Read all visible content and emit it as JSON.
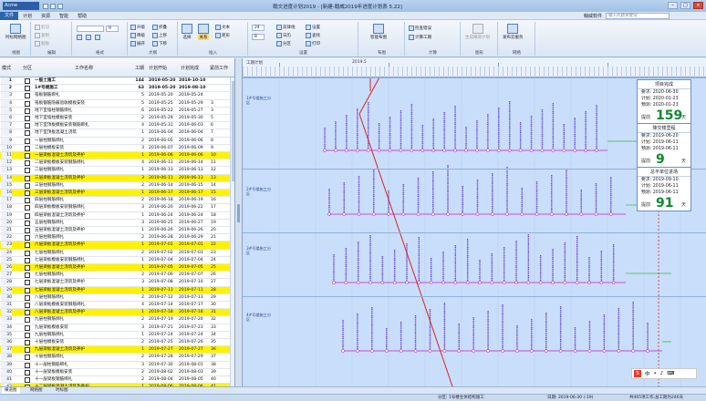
{
  "app": {
    "logo": "Acme",
    "title": "翰文进度计划2019 - [新建-翰威2019年进度计划表 5.22]"
  },
  "menu": {
    "items": [
      "文件",
      "计划",
      "资源",
      "智能",
      "帮助"
    ],
    "active": "文件",
    "right_label": "翰威软件",
    "search_placeholder": "输入问题关键词"
  },
  "ribbon": {
    "groups": [
      "视图",
      "编辑",
      "格式",
      "大纲",
      "插入",
      "设置",
      "布图",
      "计算",
      "图形",
      "网络"
    ],
    "buttons": {
      "timescale_view": "时标网络图",
      "edit1": "剪切",
      "edit2": "复制",
      "edit3": "粘贴",
      "outline1": "升级",
      "outline2": "降级",
      "outline3": "展开",
      "outline4": "折叠",
      "outline5": "上移",
      "outline6": "下移",
      "insert_select": "选择",
      "insert_relate": "关系",
      "insert_text": "文本",
      "insert_rect": "矩形",
      "settings1": "前锋线",
      "settings2": "日历",
      "settings3": "分区",
      "settings4": "设置",
      "settings5": "查找",
      "settings6": "打印",
      "layout_smart": "智能布图",
      "calc1": "检查错误",
      "calc2": "计算工期",
      "publish": "生成横道计划",
      "network": "发布云服务"
    },
    "numbers": {
      "font_size": "9",
      "zoom1": "24",
      "zoom2": "8"
    }
  },
  "grid": {
    "headers": {
      "col_mode": "模式",
      "col_partition": "分区",
      "col_name": "工作名称",
      "col_duration": "工期",
      "col_start": "计划开始",
      "col_end": "计划完成",
      "col_predecessor": "紧前工作"
    },
    "rows": [
      {
        "idx": "1",
        "name": "一般土施工",
        "dur": "144",
        "start": "2019-05-20",
        "end": "2019-10-10",
        "pred": "",
        "hl": false,
        "sum": true
      },
      {
        "idx": "2",
        "name": "1#号楼施工",
        "dur": "63",
        "start": "2019-05-20",
        "end": "2019-08-10",
        "pred": "",
        "hl": false,
        "sum": true
      },
      {
        "idx": "3",
        "name": "筏板钢筋绑扎",
        "dur": "5",
        "start": "2019-05-20",
        "end": "2019-05-24",
        "pred": "",
        "hl": false
      },
      {
        "idx": "4",
        "name": "筏板钢筋隐蔽验收模板安装",
        "dur": "5",
        "start": "2019-05-25",
        "end": "2019-05-29",
        "pred": "3",
        "hl": false
      },
      {
        "idx": "5",
        "name": "地下室墙柱钢筋绑扎",
        "dur": "6",
        "start": "2019-05-22",
        "end": "2019-05-27",
        "pred": "3",
        "hl": false
      },
      {
        "idx": "6",
        "name": "地下室墙柱模板安装",
        "dur": "2",
        "start": "2019-05-29",
        "end": "2019-05-30",
        "pred": "5",
        "hl": false
      },
      {
        "idx": "7",
        "name": "地下室顶板模板安装钢筋绑扎",
        "dur": "4",
        "start": "2019-05-31",
        "end": "2019-06-03",
        "pred": "6",
        "hl": false
      },
      {
        "idx": "8",
        "name": "地下室顶板混凝土浇筑",
        "dur": "1",
        "start": "2019-06-04",
        "end": "2019-06-04",
        "pred": "7",
        "hl": false
      },
      {
        "idx": "9",
        "name": "一层柱钢筋绑扎",
        "dur": "2",
        "start": "2019-06-05",
        "end": "2019-06-06",
        "pred": "8",
        "hl": false
      },
      {
        "idx": "10",
        "name": "二层柱模板安装",
        "dur": "3",
        "start": "2019-06-07",
        "end": "2019-06-09",
        "pred": "9",
        "hl": false
      },
      {
        "idx": "11",
        "name": "一层梁板混凝土浇筑及养护",
        "dur": "1",
        "start": "2019-06-06",
        "end": "2019-06-06",
        "pred": "10",
        "hl": true
      },
      {
        "idx": "12",
        "name": "二层梁板模板安装钢筋绑扎",
        "dur": "4",
        "start": "2019-06-11",
        "end": "2019-06-14",
        "pred": "11",
        "hl": false
      },
      {
        "idx": "13",
        "name": "二层柱钢筋绑扎",
        "dur": "1",
        "start": "2019-06-13",
        "end": "2019-06-13",
        "pred": "12",
        "hl": false
      },
      {
        "idx": "14",
        "name": "三层梁板混凝土浇筑及养护",
        "dur": "3",
        "start": "2019-06-11",
        "end": "2019-06-13",
        "pred": "13",
        "hl": true
      },
      {
        "idx": "15",
        "name": "三层柱钢筋绑扎",
        "dur": "2",
        "start": "2019-06-14",
        "end": "2019-06-15",
        "pred": "14",
        "hl": false
      },
      {
        "idx": "16",
        "name": "三层梁板混凝土浇筑及养护",
        "dur": "1",
        "start": "2019-06-17",
        "end": "2019-06-17",
        "pred": "15",
        "hl": true
      },
      {
        "idx": "17",
        "name": "四层柱钢筋绑扎",
        "dur": "2",
        "start": "2019-06-18",
        "end": "2019-06-19",
        "pred": "16",
        "hl": false
      },
      {
        "idx": "18",
        "name": "四层梁板模板安装钢筋绑扎",
        "dur": "3",
        "start": "2019-06-20",
        "end": "2019-06-22",
        "pred": "17",
        "hl": false
      },
      {
        "idx": "19",
        "name": "四层梁板混凝土浇筑及养护",
        "dur": "1",
        "start": "2019-06-24",
        "end": "2019-06-24",
        "pred": "18",
        "hl": false
      },
      {
        "idx": "20",
        "name": "五层柱钢筋绑扎",
        "dur": "3",
        "start": "2019-06-25",
        "end": "2019-06-27",
        "pred": "19",
        "hl": false
      },
      {
        "idx": "21",
        "name": "五层梁板混凝土浇筑及养护",
        "dur": "1",
        "start": "2019-06-26",
        "end": "2019-06-26",
        "pred": "20",
        "hl": false
      },
      {
        "idx": "22",
        "name": "六层柱钢筋绑扎",
        "dur": "2",
        "start": "2019-06-28",
        "end": "2019-06-29",
        "pred": "21",
        "hl": false
      },
      {
        "idx": "23",
        "name": "六层梁板混凝土浇筑及养护",
        "dur": "1",
        "start": "2019-07-01",
        "end": "2019-07-01",
        "pred": "22",
        "hl": true
      },
      {
        "idx": "24",
        "name": "七层柱钢筋绑扎",
        "dur": "2",
        "start": "2019-07-02",
        "end": "2019-07-03",
        "pred": "23",
        "hl": false
      },
      {
        "idx": "25",
        "name": "七层梁板模板安装钢筋绑扎",
        "dur": "1",
        "start": "2019-07-04",
        "end": "2019-07-04",
        "pred": "24",
        "hl": false
      },
      {
        "idx": "26",
        "name": "六层梁板混凝土浇筑及养护",
        "dur": "1",
        "start": "2019-07-05",
        "end": "2019-07-05",
        "pred": "25",
        "hl": true
      },
      {
        "idx": "27",
        "name": "七层柱钢筋绑扎",
        "dur": "2",
        "start": "2019-07-06",
        "end": "2019-07-07",
        "pred": "26",
        "hl": false
      },
      {
        "idx": "28",
        "name": "七层梁板混凝土浇筑及养护",
        "dur": "3",
        "start": "2019-07-08",
        "end": "2019-07-10",
        "pred": "27",
        "hl": false
      },
      {
        "idx": "29",
        "name": "七层梁板混凝土浇筑及养护",
        "dur": "1",
        "start": "2019-07-11",
        "end": "2019-07-11",
        "pred": "28",
        "hl": true
      },
      {
        "idx": "30",
        "name": "八层柱钢筋绑扎",
        "dur": "2",
        "start": "2019-07-12",
        "end": "2019-07-13",
        "pred": "29",
        "hl": false
      },
      {
        "idx": "31",
        "name": "八层梁板模板安装钢筋绑扎",
        "dur": "4",
        "start": "2019-07-14",
        "end": "2019-07-17",
        "pred": "30",
        "hl": false
      },
      {
        "idx": "32",
        "name": "八层梁板混凝土浇筑及养护",
        "dur": "1",
        "start": "2019-07-18",
        "end": "2019-07-18",
        "pred": "31",
        "hl": true
      },
      {
        "idx": "33",
        "name": "九层柱钢筋绑扎",
        "dur": "2",
        "start": "2019-07-19",
        "end": "2019-07-20",
        "pred": "32",
        "hl": false
      },
      {
        "idx": "34",
        "name": "九层梁板模板安装",
        "dur": "3",
        "start": "2019-07-21",
        "end": "2019-07-23",
        "pred": "33",
        "hl": false
      },
      {
        "idx": "35",
        "name": "九层柱钢筋绑扎",
        "dur": "1",
        "start": "2019-07-24",
        "end": "2019-07-24",
        "pred": "34",
        "hl": false
      },
      {
        "idx": "36",
        "name": "十层柱模板安装",
        "dur": "2",
        "start": "2019-07-25",
        "end": "2019-07-26",
        "pred": "35",
        "hl": false
      },
      {
        "idx": "37",
        "name": "九层梁板混凝土浇筑及养护",
        "dur": "1",
        "start": "2019-07-27",
        "end": "2019-07-27",
        "pred": "36",
        "hl": true
      },
      {
        "idx": "38",
        "name": "十层柱钢筋绑扎",
        "dur": "2",
        "start": "2019-07-28",
        "end": "2019-07-29",
        "pred": "37",
        "hl": false
      },
      {
        "idx": "39",
        "name": "十一层柱钢筋绑扎",
        "dur": "3",
        "start": "2019-07-30",
        "end": "2019-08-01",
        "pred": "38",
        "hl": false
      },
      {
        "idx": "40",
        "name": "十一层梁板模板安装",
        "dur": "2",
        "start": "2019-08-02",
        "end": "2019-08-03",
        "pred": "39",
        "hl": false
      },
      {
        "idx": "41",
        "name": "十一层梁板钢筋绑扎",
        "dur": "2",
        "start": "2019-08-04",
        "end": "2019-08-05",
        "pred": "40",
        "hl": false
      },
      {
        "idx": "42",
        "name": "十二层梁板混凝土浇筑及养护",
        "dur": "1",
        "start": "2019-08-06",
        "end": "2019-08-06",
        "pred": "41",
        "hl": true
      },
      {
        "idx": "43",
        "name": "十二层柱钢筋绑扎",
        "dur": "2",
        "start": "2019-08-07",
        "end": "2019-08-08",
        "pred": "42",
        "hl": false
      }
    ]
  },
  "timescale": {
    "title": "工期计划",
    "year": "2019.5"
  },
  "lanes": [
    {
      "label": "1#号楼施工分区"
    },
    {
      "label": "2#号楼施工分区"
    },
    {
      "label": "3#号楼施工分区"
    },
    {
      "label": "4#号楼施工分区"
    }
  ],
  "info_boxes": [
    {
      "title": "项目完成",
      "plan_label": "要求:",
      "plan": "2020-06-30",
      "calc_label": "计划:",
      "calc": "2020-01-23",
      "pred_label": "预测:",
      "pred": "2020-01-23",
      "big_label": "提前",
      "big": "159",
      "unit": "天"
    },
    {
      "title": "降交楼里程",
      "plan_label": "要求:",
      "plan": "2019-06-20",
      "calc_label": "计划:",
      "calc": "2019-06-11",
      "pred_label": "预测:",
      "pred": "2019-06-11",
      "big_label": "提前",
      "big": "9",
      "unit": "天"
    },
    {
      "title": "总平单位进场",
      "plan_label": "要求:",
      "plan": "2019-09-10",
      "calc_label": "计划:",
      "calc": "2019-06-11",
      "pred_label": "预测:",
      "pred": "2019-06-11",
      "big_label": "提前",
      "big": "91",
      "unit": "天"
    }
  ],
  "bottom_tabs": [
    "横道图",
    "网络图",
    "时标图"
  ],
  "status": {
    "left": "分区: 1号楼主体结构施工",
    "date": "日期: 2019-06-30 (-19)",
    "total": "共405项工作,总工期为246天"
  },
  "colors": {
    "accent": "#2d64ae",
    "highlight": "#fff200",
    "chart_bg": "#c9defa",
    "critical": "#e02020",
    "milestone": "#0b8a2f"
  }
}
